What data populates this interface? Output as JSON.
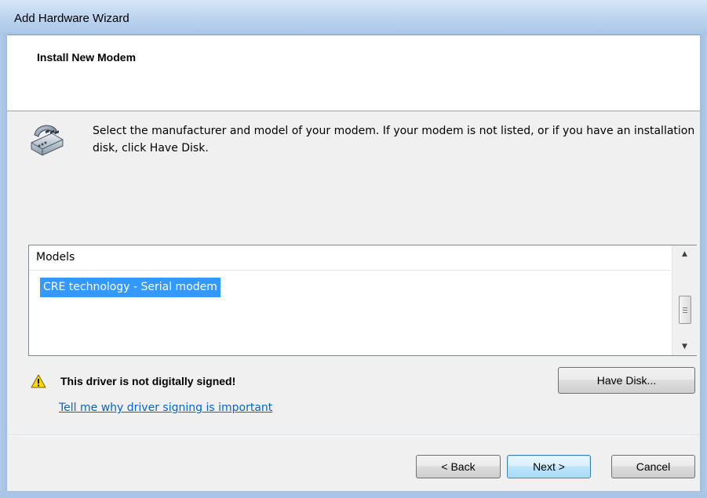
{
  "window": {
    "title": "Add Hardware Wizard"
  },
  "header": {
    "title": "Install New Modem"
  },
  "instructions": "Select the manufacturer and model of your modem. If your modem is not listed, or if you have an installation disk, click Have Disk.",
  "models": {
    "header": "Models",
    "items": [
      "CRE technology - Serial modem"
    ],
    "selected_index": 0
  },
  "warning": {
    "text": "This driver is not digitally signed!",
    "link": "Tell me why driver signing is important"
  },
  "buttons": {
    "have_disk": "Have Disk...",
    "back": "< Back",
    "next": "Next >",
    "cancel": "Cancel"
  },
  "icons": {
    "modem": "modem-icon",
    "warning": "warning-icon",
    "scroll_up": "scroll-up-arrow-icon",
    "scroll_down": "scroll-down-arrow-icon"
  },
  "colors": {
    "selection": "#3399ff",
    "link": "#0066cc",
    "title_bar": "#bfd6ef",
    "content_bg": "#f0f0f0"
  }
}
